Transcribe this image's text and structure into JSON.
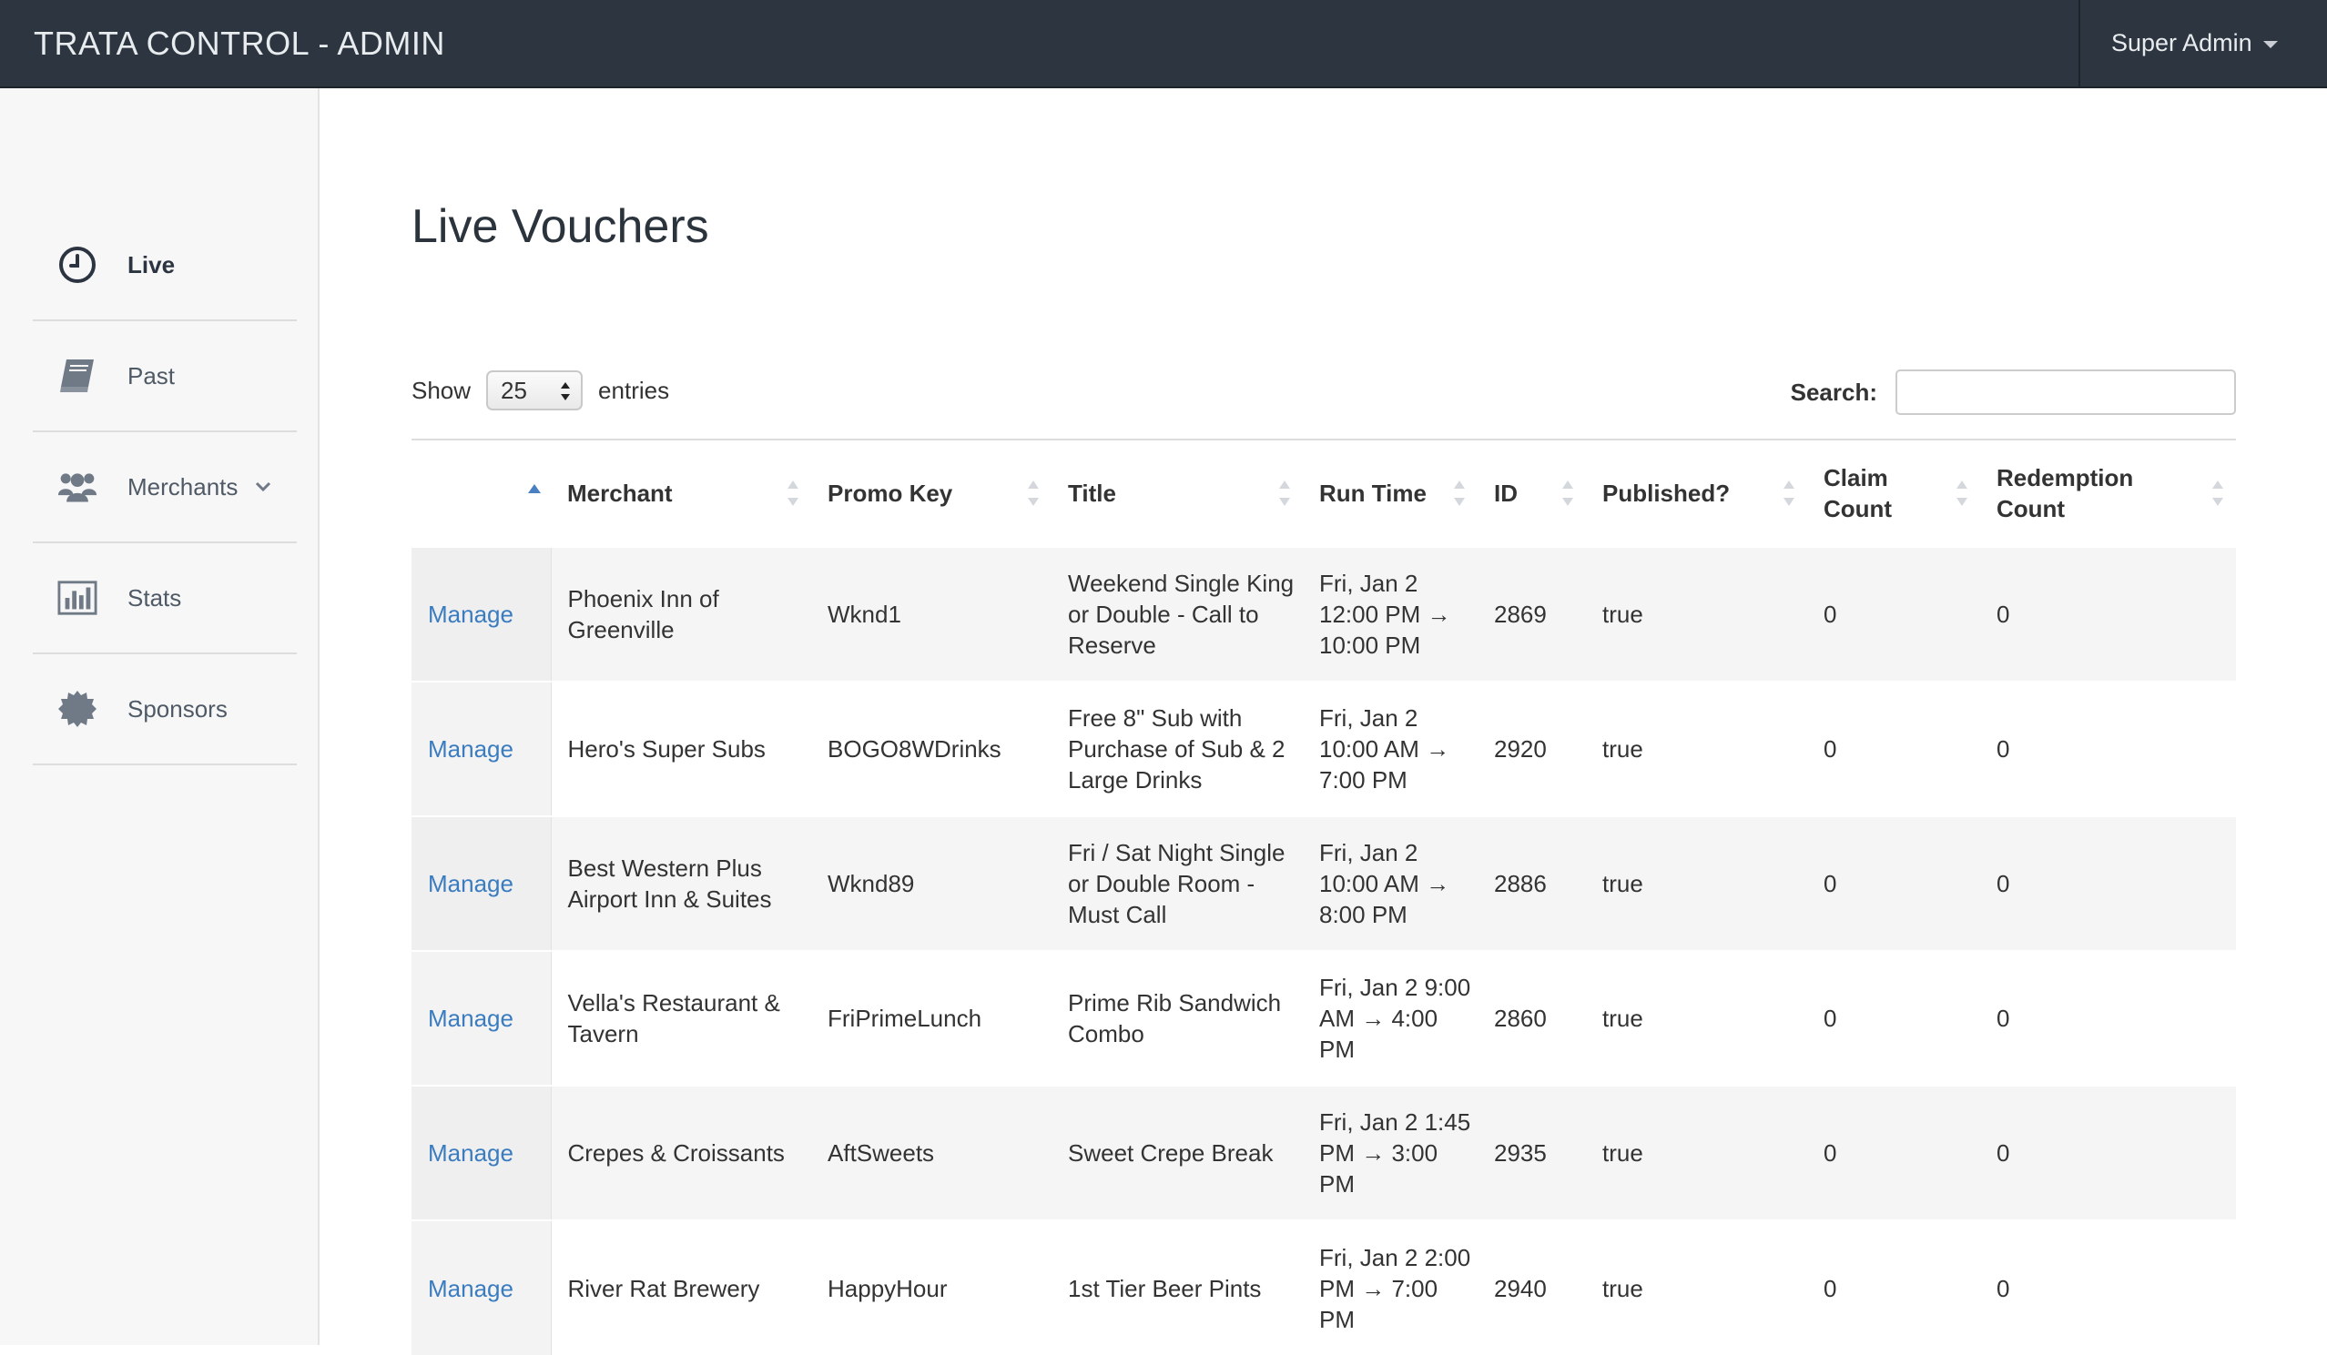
{
  "app": {
    "brand": "TRATA CONTROL - ADMIN",
    "user_menu_label": "Super Admin"
  },
  "sidebar": {
    "items": [
      {
        "label": "Live",
        "icon": "clock-icon",
        "active": true
      },
      {
        "label": "Past",
        "icon": "book-icon",
        "active": false
      },
      {
        "label": "Merchants",
        "icon": "users-icon",
        "active": false,
        "has_submenu": true
      },
      {
        "label": "Stats",
        "icon": "bar-chart-icon",
        "active": false
      },
      {
        "label": "Sponsors",
        "icon": "badge-icon",
        "active": false
      }
    ]
  },
  "page": {
    "title": "Live Vouchers"
  },
  "table_controls": {
    "show_label": "Show",
    "entries_value": "25",
    "entries_label": "entries",
    "search_label": "Search:",
    "search_value": ""
  },
  "table": {
    "columns": [
      "",
      "Merchant",
      "Promo Key",
      "Title",
      "Run Time",
      "ID",
      "Published?",
      "Claim Count",
      "Redemption Count"
    ],
    "rows": [
      {
        "action": "Manage",
        "merchant": "Phoenix Inn of Greenville",
        "promo_key": "Wknd1",
        "title": "Weekend Single King or Double - Call to Reserve",
        "run_time": "Fri, Jan 2 12:00 PM → 10:00 PM",
        "id": "2869",
        "published": "true",
        "claim_count": "0",
        "redemption_count": "0"
      },
      {
        "action": "Manage",
        "merchant": "Hero's Super Subs",
        "promo_key": "BOGO8WDrinks",
        "title": "Free 8\" Sub with Purchase of Sub & 2 Large Drinks",
        "run_time": "Fri, Jan 2 10:00 AM → 7:00 PM",
        "id": "2920",
        "published": "true",
        "claim_count": "0",
        "redemption_count": "0"
      },
      {
        "action": "Manage",
        "merchant": "Best Western Plus Airport Inn & Suites",
        "promo_key": "Wknd89",
        "title": "Fri / Sat Night Single or Double Room - Must Call",
        "run_time": "Fri, Jan 2 10:00 AM → 8:00 PM",
        "id": "2886",
        "published": "true",
        "claim_count": "0",
        "redemption_count": "0"
      },
      {
        "action": "Manage",
        "merchant": "Vella's Restaurant & Tavern",
        "promo_key": "FriPrimeLunch",
        "title": "Prime Rib Sandwich Combo",
        "run_time": "Fri, Jan 2 9:00 AM → 4:00 PM",
        "id": "2860",
        "published": "true",
        "claim_count": "0",
        "redemption_count": "0"
      },
      {
        "action": "Manage",
        "merchant": "Crepes & Croissants",
        "promo_key": "AftSweets",
        "title": "Sweet Crepe Break",
        "run_time": "Fri, Jan 2 1:45 PM → 3:00 PM",
        "id": "2935",
        "published": "true",
        "claim_count": "0",
        "redemption_count": "0"
      },
      {
        "action": "Manage",
        "merchant": "River Rat Brewery",
        "promo_key": "HappyHour",
        "title": "1st Tier Beer Pints",
        "run_time": "Fri, Jan 2 2:00 PM → 7:00 PM",
        "id": "2940",
        "published": "true",
        "claim_count": "0",
        "redemption_count": "0"
      }
    ]
  },
  "colors": {
    "navbar_bg": "#2c3540",
    "link": "#3a7cbf",
    "sidebar_bg": "#f7f7f7",
    "sort_active": "#4a7fc1"
  }
}
